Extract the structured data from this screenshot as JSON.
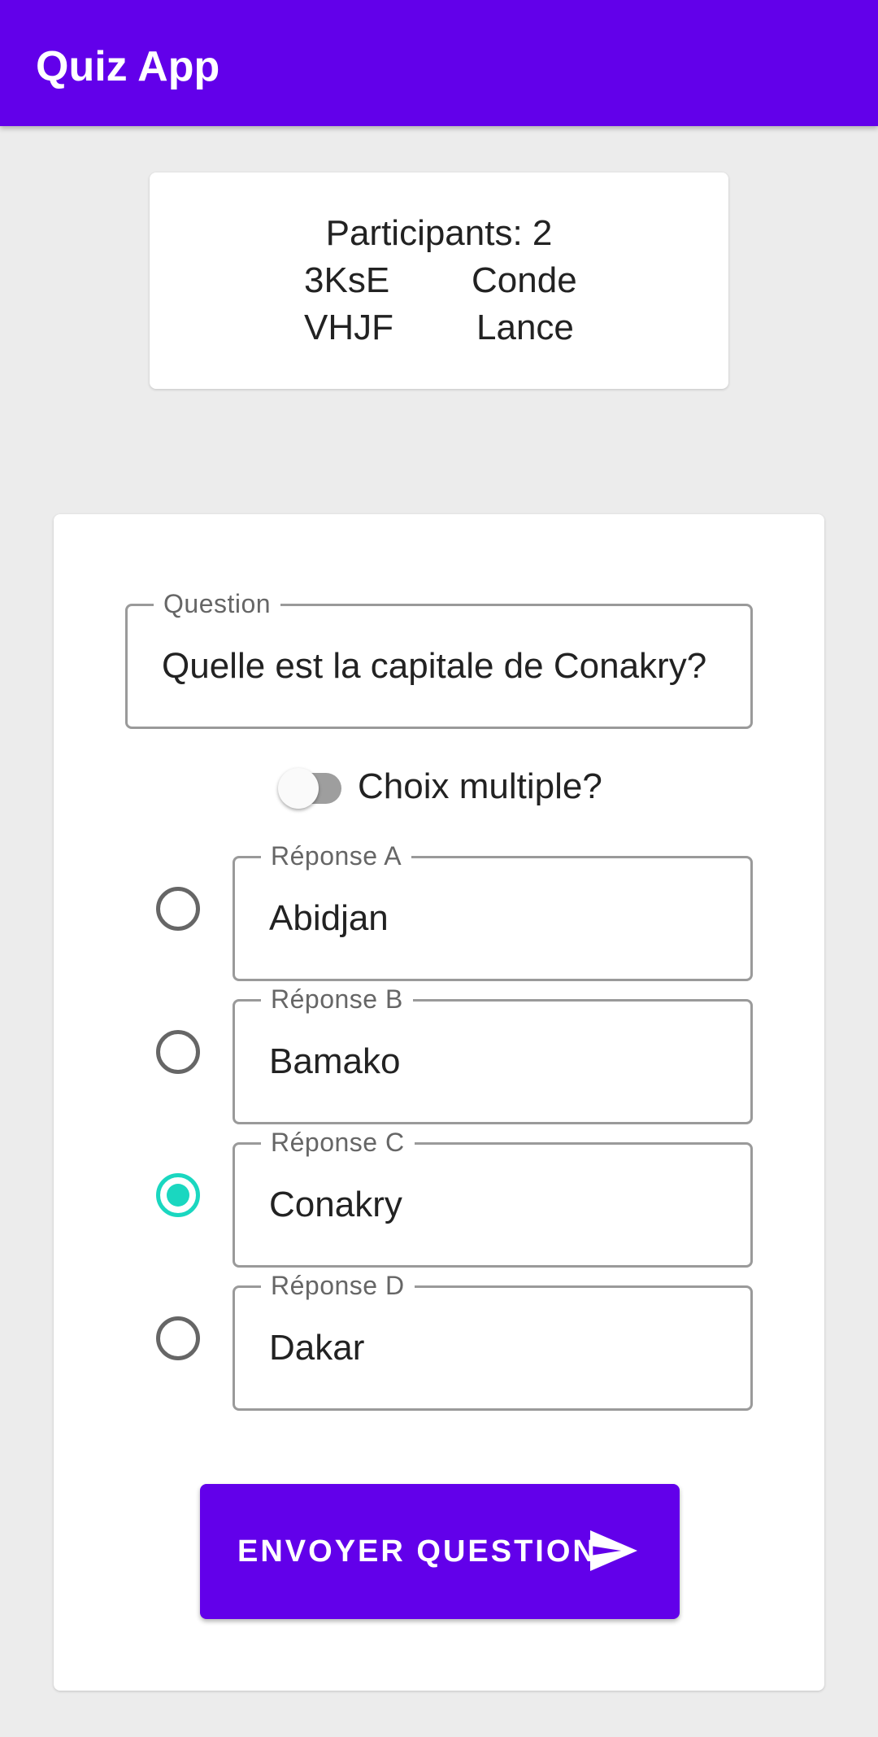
{
  "app": {
    "title": "Quiz App",
    "primary_color": "#6200ea",
    "accent_color": "#1ad7c0"
  },
  "participants": {
    "count_label": "Participants: 2",
    "list": [
      {
        "code": "3KsE",
        "name": "Conde"
      },
      {
        "code": "VHJF",
        "name": "Lance"
      }
    ]
  },
  "form": {
    "question": {
      "label": "Question",
      "value": "Quelle est la capitale de Conakry?"
    },
    "multiple_choice": {
      "label": "Choix multiple?",
      "enabled": false
    },
    "answers": [
      {
        "label": "Réponse A",
        "value": "Abidjan",
        "selected": false
      },
      {
        "label": "Réponse B",
        "value": "Bamako",
        "selected": false
      },
      {
        "label": "Réponse C",
        "value": "Conakry",
        "selected": true
      },
      {
        "label": "Réponse D",
        "value": "Dakar",
        "selected": false
      }
    ],
    "submit_label": "ENVOYER QUESTION",
    "submit_icon": "send-icon"
  }
}
